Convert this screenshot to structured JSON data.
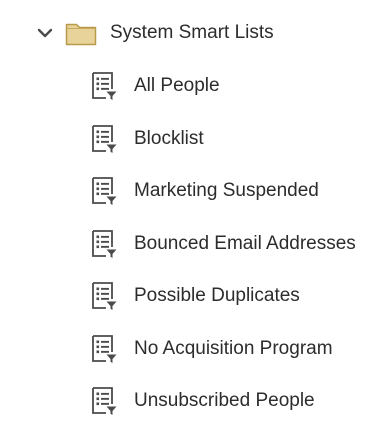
{
  "folder": {
    "label": "System Smart Lists",
    "icon": "folder-icon",
    "expanded": true,
    "chevron_icon": "chevron-down-icon"
  },
  "items": [
    {
      "label": "All People",
      "icon": "smart-list-icon"
    },
    {
      "label": "Blocklist",
      "icon": "smart-list-icon"
    },
    {
      "label": "Marketing Suspended",
      "icon": "smart-list-icon"
    },
    {
      "label": "Bounced Email Addresses",
      "icon": "smart-list-icon"
    },
    {
      "label": "Possible Duplicates",
      "icon": "smart-list-icon"
    },
    {
      "label": "No Acquisition Program",
      "icon": "smart-list-icon"
    },
    {
      "label": "Unsubscribed People",
      "icon": "smart-list-icon"
    }
  ],
  "colors": {
    "text": "#2c2c2c",
    "icon": "#4b4b4b",
    "folder_fill": "#e8d49b",
    "folder_stroke": "#b99a4a"
  }
}
